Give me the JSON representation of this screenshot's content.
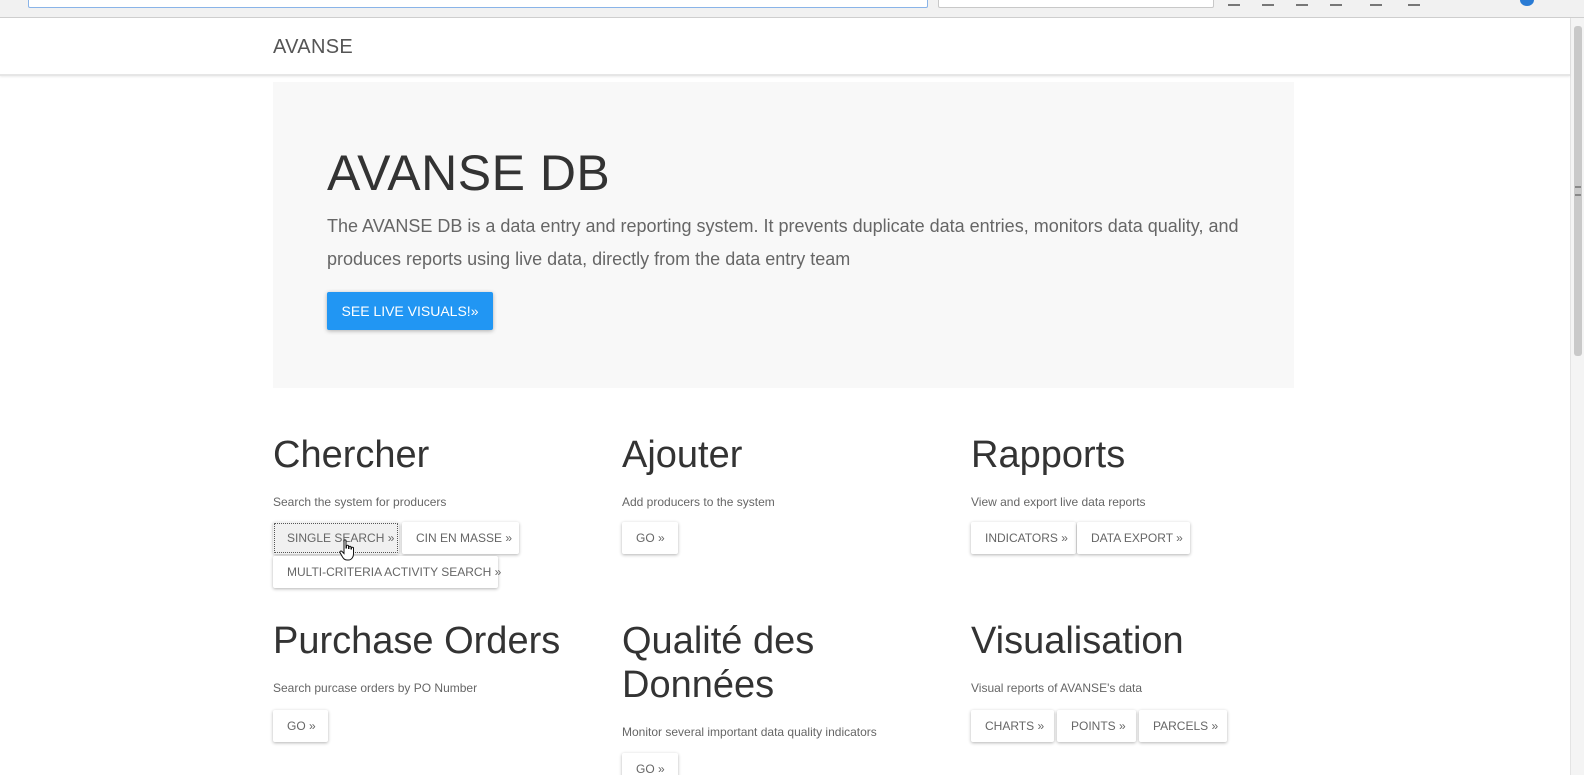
{
  "brand": "AVANSE",
  "jumbotron": {
    "title": "AVANSE DB",
    "description": "The AVANSE DB is a data entry and reporting system. It prevents duplicate data entries, monitors data quality, and produces reports using live data, directly from the data entry team",
    "cta_label": "SEE LIVE VISUALS!»"
  },
  "sections": {
    "chercher": {
      "title": "Chercher",
      "description": "Search the system for producers",
      "buttons": [
        "SINGLE SEARCH »",
        "CIN EN MASSE »",
        "MULTI-CRITERIA ACTIVITY SEARCH »"
      ]
    },
    "ajouter": {
      "title": "Ajouter",
      "description": "Add producers to the system",
      "buttons": [
        "GO »"
      ]
    },
    "rapports": {
      "title": "Rapports",
      "description": "View and export live data reports",
      "buttons": [
        "INDICATORS »",
        "DATA EXPORT »"
      ]
    },
    "purchase_orders": {
      "title": "Purchase Orders",
      "description": "Search purcase orders by PO Number",
      "buttons": [
        "GO »"
      ]
    },
    "qualite": {
      "title": "Qualité des Données",
      "description": "Monitor several important data quality indicators",
      "buttons": [
        "GO »"
      ]
    },
    "visualisation": {
      "title": "Visualisation",
      "description": "Visual reports of AVANSE's data",
      "buttons": [
        "CHARTS »",
        "POINTS »",
        "PARCELS »"
      ]
    }
  },
  "colors": {
    "primary": "#2196f3",
    "jumbotron_bg": "#f8f8f8",
    "text": "#333333",
    "muted_text": "#666666"
  }
}
